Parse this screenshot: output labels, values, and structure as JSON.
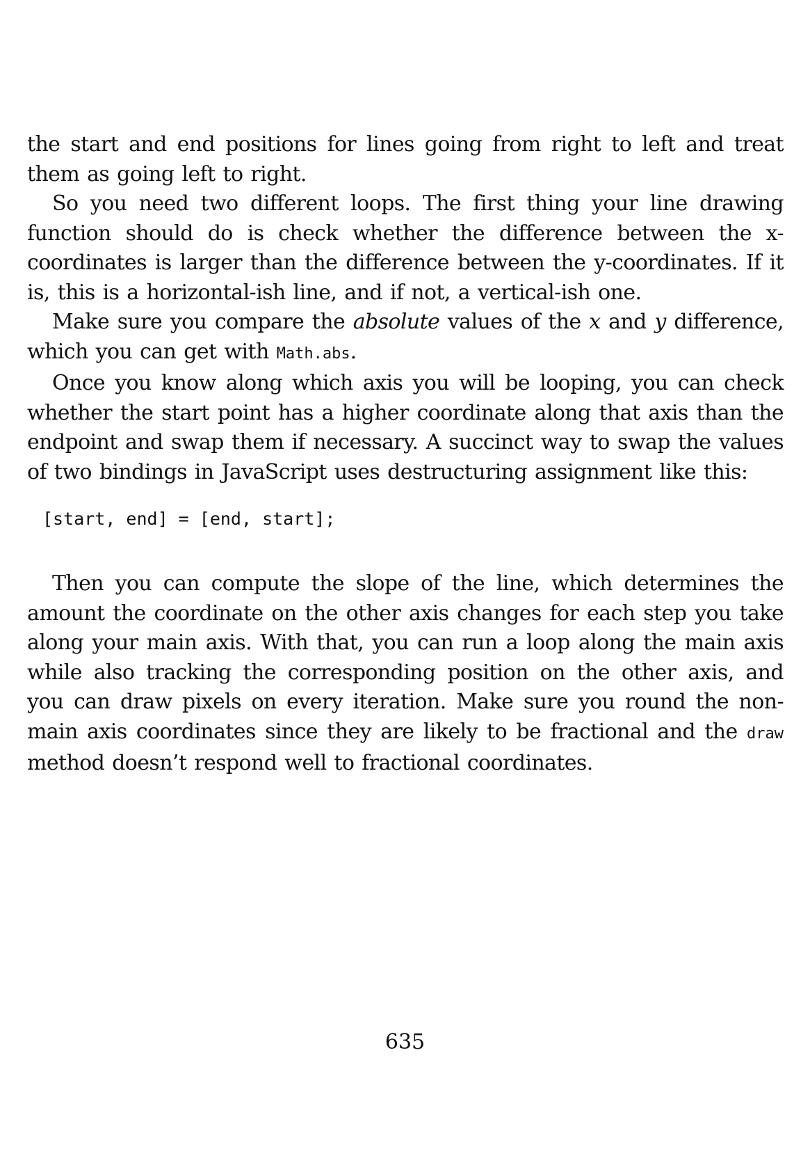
{
  "paragraphs": {
    "p1": "the start and end positions for lines going from right to left and treat them as going left to right.",
    "p2": "So you need two different loops. The first thing your line drawing function should do is check whether the difference between the x-coordinates is larger than the difference between the y-coordinates. If it is, this is a horizontal-ish line, and if not, a vertical-ish one.",
    "p3": {
      "a": "Make sure you compare the ",
      "b": "absolute",
      "c": " values of the ",
      "d": "x",
      "e": " and ",
      "f": "y",
      "g": " difference, which you can get with ",
      "h": "Math.abs",
      "i": "."
    },
    "p4": "Once you know along which axis you will be looping, you can check whether the start point has a higher coordinate along that axis than the endpoint and swap them if necessary. A succinct way to swap the values of two bindings in JavaScript uses destructuring assignment like this:",
    "code": "[start, end] = [end, start];",
    "p5": {
      "a": "Then you can compute the slope of the line, which determines the amount the coordinate on the other axis changes for each step you take along your main axis. With that, you can run a loop along the main axis while also tracking the corresponding position on the other axis, and you can draw pixels on every iteration. Make sure you round the non-main axis coordinates since they are likely to be fractional and the ",
      "b": "draw",
      "c": " method doesn’t respond well to fractional coordinates."
    }
  },
  "page_number": "635"
}
